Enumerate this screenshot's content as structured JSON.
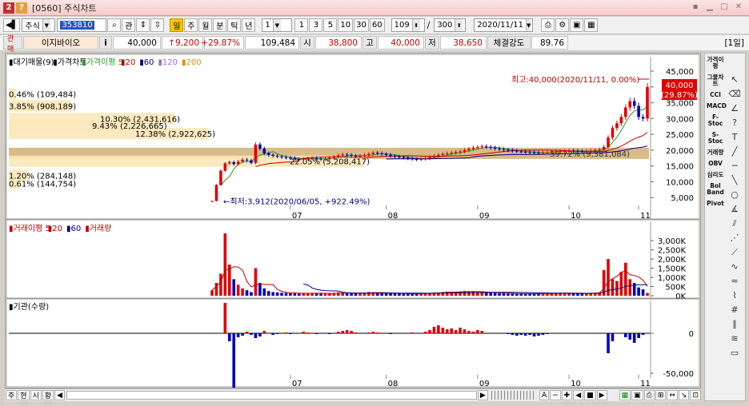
{
  "window": {
    "title": "[0560] 주식차트"
  },
  "toolbar": {
    "market": "주식",
    "code": "353810",
    "btn_gwan": "관",
    "periods": [
      "일",
      "주",
      "월",
      "분",
      "틱",
      "년"
    ],
    "active_period": "일",
    "interval": "1",
    "interval_buttons": [
      "1",
      "3",
      "5",
      "10",
      "30",
      "60"
    ],
    "count": "109",
    "total": "300",
    "date": "2020/11/11"
  },
  "info": {
    "tag": "관매",
    "name": "이지바이오",
    "i_btn": "i",
    "price": "40,000",
    "change": "↑9,200",
    "rate": "+29.87%",
    "volume": "109,484",
    "open_label": "시",
    "open": "38,800",
    "high_label": "고",
    "high": "40,000",
    "low_label": "저",
    "low": "38,650",
    "strength_label": "체결강도",
    "strength": "89.76",
    "period_tag": "[1일]"
  },
  "price_panel": {
    "legend": [
      "▮대기매물(9)",
      "▮가격차트",
      "▮가격이평 5",
      "▮20",
      "▮60",
      "▮120",
      "▮200"
    ],
    "legend_colors": [
      "#000000",
      "#000000",
      "#2a9a2a",
      "#c00000",
      "#000080",
      "#a070d0",
      "#e09000"
    ],
    "high_note": "최고:40,000(2020/11/11, 0.00%)",
    "low_note": "←최저:3,912(2020/06/05, +922.49%)",
    "current_price": "40,000",
    "current_rate": "(29.87%)",
    "y_ticks": [
      "45,000",
      "40,000",
      "35,000",
      "30,000",
      "25,000",
      "20,000",
      "15,000",
      "10,000",
      "5,000"
    ],
    "pending_orders": [
      {
        "label": "0.46% (109,484)",
        "pct": 0.46,
        "price_level": 37750
      },
      {
        "label": "3.85% (908,189)",
        "pct": 3.85,
        "price_level": 34000
      },
      {
        "label": "10.30% (2,431,616)",
        "pct": 10.3,
        "price_level": 30000
      },
      {
        "label": "9.43% (2,226,665)",
        "pct": 9.43,
        "price_level": 27750
      },
      {
        "label": "12.38% (2,922,625)",
        "pct": 12.38,
        "price_level": 25250
      },
      {
        "label": "39.72% (9,381,084)",
        "pct": 39.72,
        "price_level": 19000
      },
      {
        "label": "22.05% (5,208,417)",
        "pct": 22.05,
        "price_level": 16500
      },
      {
        "label": "1.20% (284,148)",
        "pct": 1.2,
        "price_level": 12000
      },
      {
        "label": "0.61% (144,754)",
        "pct": 0.61,
        "price_level": 9500
      }
    ],
    "x_ticks": [
      "07",
      "08",
      "09",
      "10",
      "11"
    ]
  },
  "volume_panel": {
    "legend": [
      "▮거래이평 5",
      "▮20",
      "▮60",
      "▮거래량"
    ],
    "legend_colors": [
      "#c00000",
      "#c00000",
      "#000080",
      "#c00000"
    ],
    "y_ticks": [
      "3,000K",
      "2,500K",
      "2,000K",
      "1,500K",
      "1,000K",
      "500K",
      "0K"
    ]
  },
  "inst_panel": {
    "legend": [
      "▮기관(수량)"
    ],
    "y_ticks": [
      "0",
      "-50,000"
    ],
    "x_ticks": [
      "07",
      "08",
      "09",
      "10",
      "11"
    ]
  },
  "right_panel": {
    "items": [
      "가격이평",
      "그물차트",
      "CCI",
      "MACD",
      "F-Stoc",
      "S-Stoc",
      "거래량",
      "OBV",
      "심리도",
      "Bol Band",
      "Pivot"
    ]
  },
  "bottom": {
    "tabs": [
      "주",
      "현",
      "시",
      "황"
    ],
    "controls": [
      "A",
      "−",
      "✚",
      "◀",
      "■",
      "▶"
    ]
  },
  "chart_data": {
    "type": "candlestick",
    "price_ylim": [
      0,
      45000
    ],
    "high": {
      "value": 40000,
      "date": "2020/11/11"
    },
    "low": {
      "value": 3912,
      "date": "2020/06/05"
    },
    "closes": [
      3912,
      9000,
      13500,
      15800,
      16200,
      15600,
      16400,
      17000,
      16800,
      16000,
      21800,
      20500,
      19000,
      18500,
      18200,
      18000,
      17800,
      17600,
      17500,
      17200,
      17000,
      17300,
      17400,
      17500,
      17300,
      17100,
      17200,
      17600,
      17900,
      18300,
      18600,
      18500,
      18200,
      18000,
      18200,
      18500,
      18800,
      19200,
      19000,
      18800,
      18500,
      18200,
      18000,
      17800,
      17600,
      17400,
      17200,
      17000,
      17200,
      17400,
      17800,
      18200,
      18500,
      18800,
      19000,
      19200,
      19400,
      19600,
      20000,
      20400,
      20800,
      21000,
      21200,
      21000,
      20800,
      20500,
      20300,
      20100,
      20000,
      19800,
      19600,
      19500,
      19400,
      19300,
      19200,
      19100,
      19200,
      19300,
      19500,
      19600,
      19700,
      19800,
      19900,
      19800,
      19700,
      19600,
      19700,
      19800,
      20000,
      20200,
      21000,
      24000,
      27000,
      28500,
      30500,
      33500,
      35500,
      34000,
      30500,
      30000,
      40000
    ],
    "volumes_k": [
      300,
      700,
      1200,
      3400,
      1700,
      900,
      600,
      400,
      300,
      200,
      1500,
      700,
      400,
      250,
      200,
      180,
      160,
      150,
      140,
      130,
      120,
      130,
      140,
      150,
      130,
      120,
      110,
      130,
      150,
      180,
      160,
      140,
      130,
      120,
      140,
      160,
      200,
      180,
      160,
      150,
      140,
      130,
      120,
      110,
      100,
      110,
      120,
      110,
      120,
      130,
      150,
      170,
      180,
      200,
      220,
      210,
      200,
      230,
      260,
      240,
      220,
      200,
      180,
      170,
      160,
      150,
      140,
      130,
      120,
      110,
      100,
      110,
      120,
      110,
      100,
      110,
      120,
      130,
      140,
      150,
      160,
      150,
      140,
      130,
      120,
      130,
      140,
      150,
      160,
      180,
      1400,
      2000,
      900,
      800,
      1300,
      1800,
      900,
      700,
      450,
      350,
      150
    ],
    "inst_qty": [
      0,
      0,
      0,
      38000,
      -10000,
      -78000,
      -5000,
      -3000,
      2000,
      -2000,
      -6000,
      -4000,
      3000,
      0,
      -2000,
      -1000,
      0,
      1000,
      -1000,
      0,
      0,
      2000,
      1000,
      0,
      -1000,
      0,
      0,
      -1000,
      0,
      2000,
      3000,
      4000,
      3000,
      1000,
      0,
      0,
      1000,
      2000,
      1000,
      0,
      0,
      -1000,
      0,
      0,
      0,
      0,
      1000,
      0,
      0,
      2000,
      4000,
      8000,
      10000,
      7000,
      5000,
      6000,
      4000,
      7000,
      5000,
      3000,
      2000,
      4000,
      3000,
      0,
      0,
      0,
      0,
      0,
      -1000,
      -2000,
      -3000,
      -2000,
      -3000,
      -2000,
      -4000,
      -3000,
      -2000,
      -1000,
      0,
      0,
      0,
      0,
      0,
      0,
      0,
      0,
      0,
      0,
      0,
      0,
      0,
      -25000,
      -10000,
      0,
      0,
      -5000,
      -8000,
      -12000,
      -6000,
      -2000,
      0
    ],
    "x_ticks": [
      "07",
      "08",
      "09",
      "10",
      "11"
    ]
  }
}
